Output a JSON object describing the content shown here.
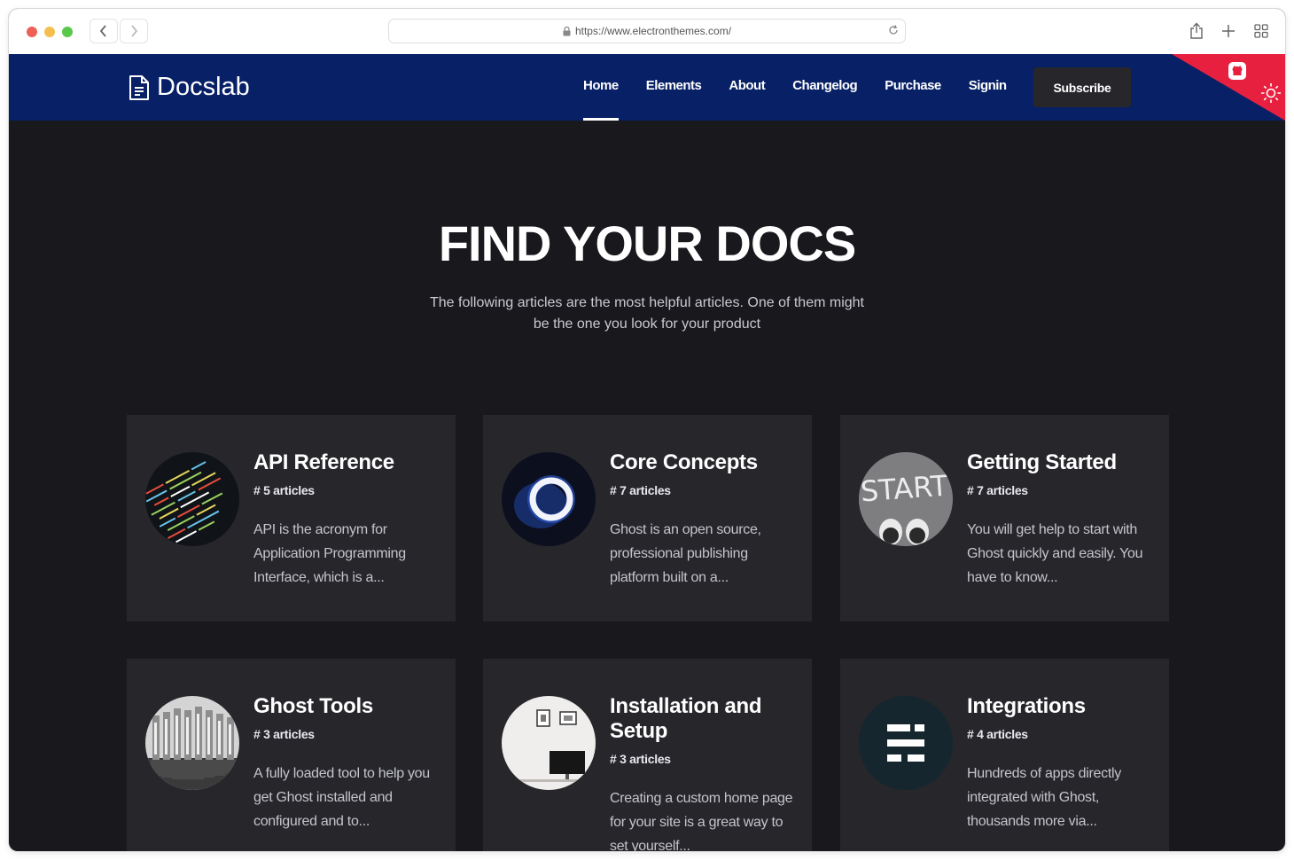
{
  "browser": {
    "url": "https://www.electronthemes.com/"
  },
  "header": {
    "logo_text": "Docslab",
    "nav": [
      {
        "label": "Home",
        "active": true
      },
      {
        "label": "Elements",
        "active": false
      },
      {
        "label": "About",
        "active": false
      },
      {
        "label": "Changelog",
        "active": false
      },
      {
        "label": "Purchase",
        "active": false
      },
      {
        "label": "Signin",
        "active": false
      }
    ],
    "subscribe_label": "Subscribe",
    "corner_icons": [
      "github-icon",
      "sun-icon"
    ],
    "colors": {
      "header_bg": "#072066",
      "corner_bg": "#e8203f",
      "page_bg": "#18181d",
      "card_bg": "#26262b"
    }
  },
  "hero": {
    "title": "FIND YOUR DOCS",
    "subtitle": "The following articles are the most helpful articles. One of them might be the one you look for your product"
  },
  "cards": [
    {
      "title": "API Reference",
      "count": "# 5 articles",
      "desc": "API is the acronym for Application Programming Interface, which is a..."
    },
    {
      "title": "Core Concepts",
      "count": "# 7 articles",
      "desc": "Ghost is an open source, professional publishing platform built on a..."
    },
    {
      "title": "Getting Started",
      "count": "# 7 articles",
      "desc": "You will get help to start with Ghost quickly and easily. You have to know..."
    },
    {
      "title": "Ghost Tools",
      "count": "# 3 articles",
      "desc": "A fully loaded tool to help you get Ghost installed and configured and to..."
    },
    {
      "title": "Installation and Setup",
      "count": "# 3 articles",
      "desc": "Creating a custom home page for your site is a great way to set yourself..."
    },
    {
      "title": "Integrations",
      "count": "# 4 articles",
      "desc": "Hundreds of apps directly integrated with Ghost, thousands more via..."
    }
  ],
  "thumb_text": {
    "start_sign": "START"
  }
}
